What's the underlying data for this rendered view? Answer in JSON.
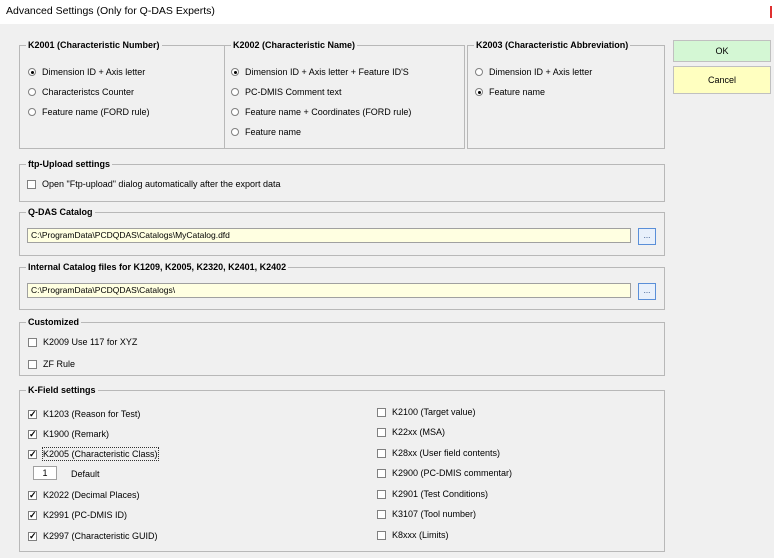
{
  "window": {
    "title": "Advanced Settings (Only for Q-DAS Experts)"
  },
  "buttons": {
    "ok": "OK",
    "cancel": "Cancel"
  },
  "colors": {
    "ok_bg": "#d4f7d4",
    "cancel_bg": "#ffffc0",
    "field_bg": "#ffffe1"
  },
  "k2001": {
    "label": "K2001 (Characteristic Number)",
    "options": [
      "Dimension ID + Axis letter",
      "Characteristcs Counter",
      "Feature name (FORD rule)"
    ]
  },
  "k2002": {
    "label": "K2002 (Characteristic Name)",
    "options": [
      "Dimension ID + Axis letter + Feature ID'S",
      "PC-DMIS Comment text",
      "Feature name + Coordinates (FORD rule)",
      "Feature name"
    ]
  },
  "k2003": {
    "label": "K2003 (Characteristic Abbreviation)",
    "options": [
      "Dimension ID + Axis letter",
      "Feature name"
    ]
  },
  "ftp": {
    "label": "ftp-Upload settings",
    "option": "Open \"Ftp-upload\" dialog automatically after the export data"
  },
  "catalog": {
    "label": "Q-DAS Catalog",
    "value": "C:\\ProgramData\\PCDQDAS\\Catalogs\\MyCatalog.dfd",
    "browse": "..."
  },
  "internal": {
    "label": "Internal Catalog files for K1209, K2005, K2320, K2401, K2402",
    "value": "C:\\ProgramData\\PCDQDAS\\Catalogs\\",
    "browse": "..."
  },
  "customized": {
    "label": "Customized",
    "options": [
      "K2009 Use 117 for XYZ",
      "ZF Rule"
    ]
  },
  "kfield": {
    "label": "K-Field settings",
    "left": [
      "K1203 (Reason for Test)",
      "K1900 (Remark)",
      "K2005 (Characteristic Class)",
      "K2022 (Decimal Places)",
      "K2991 (PC-DMIS ID)",
      "K2997 (Characteristic GUID)"
    ],
    "default_value": "1",
    "default_label": "Default",
    "right": [
      "K2100 (Target value)",
      "K22xx (MSA)",
      "K28xx (User field contents)",
      "K2900 (PC-DMIS commentar)",
      "K2901 (Test Conditions)",
      "K3107 (Tool number)",
      "K8xxx (Limits)"
    ]
  },
  "check_mark": "✓"
}
